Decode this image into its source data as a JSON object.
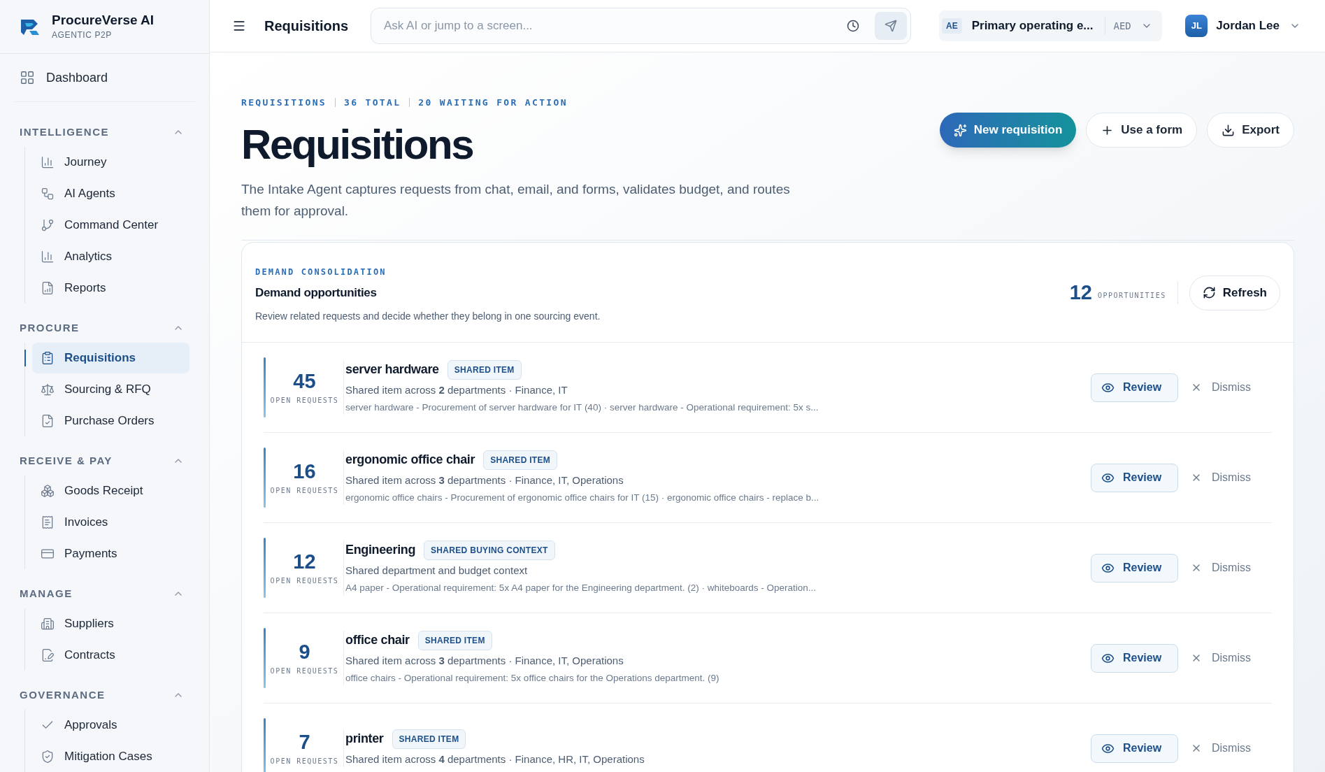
{
  "brand": {
    "name": "ProcureVerse AI",
    "tagline": "AGENTIC P2P"
  },
  "sidebar": {
    "top_item": {
      "label": "Dashboard",
      "selected": false
    },
    "sections": [
      {
        "title": "INTELLIGENCE",
        "expanded": true,
        "items": [
          {
            "label": "Journey",
            "selected": false
          },
          {
            "label": "AI Agents",
            "selected": false
          },
          {
            "label": "Command Center",
            "selected": false
          },
          {
            "label": "Analytics",
            "selected": false
          },
          {
            "label": "Reports",
            "selected": false
          }
        ]
      },
      {
        "title": "PROCURE",
        "expanded": true,
        "items": [
          {
            "label": "Requisitions",
            "selected": true
          },
          {
            "label": "Sourcing & RFQ",
            "selected": false
          },
          {
            "label": "Purchase Orders",
            "selected": false
          }
        ]
      },
      {
        "title": "RECEIVE & PAY",
        "expanded": true,
        "items": [
          {
            "label": "Goods Receipt",
            "selected": false
          },
          {
            "label": "Invoices",
            "selected": false
          },
          {
            "label": "Payments",
            "selected": false
          }
        ]
      },
      {
        "title": "MANAGE",
        "expanded": true,
        "items": [
          {
            "label": "Suppliers",
            "selected": false
          },
          {
            "label": "Contracts",
            "selected": false
          }
        ]
      },
      {
        "title": "GOVERNANCE",
        "expanded": true,
        "items": [
          {
            "label": "Approvals",
            "selected": false
          },
          {
            "label": "Mitigation Cases",
            "selected": false
          }
        ]
      }
    ]
  },
  "topbar": {
    "title": "Requisitions",
    "search": {
      "placeholder": "Ask AI or jump to a screen..."
    },
    "entity": {
      "code": "AE",
      "name": "Primary operating e...",
      "currency": "AED"
    },
    "user": {
      "initials": "JL",
      "name": "Jordan Lee"
    }
  },
  "header": {
    "stats": [
      "REQUISITIONS",
      "36 TOTAL",
      "20 WAITING FOR ACTION"
    ],
    "title": "Requisitions",
    "description": "The Intake Agent captures requests from chat, email, and forms, validates budget, and routes them for approval.",
    "buttons": [
      {
        "label": "New requisition",
        "kind": "primary"
      },
      {
        "label": "Use a form",
        "kind": "plus"
      },
      {
        "label": "Export",
        "kind": "download"
      }
    ]
  },
  "demand": {
    "eyebrow": "DEMAND CONSOLIDATION",
    "title": "Demand opportunities",
    "subtitle": "Review related requests and decide whether they belong in one sourcing event.",
    "count": "12",
    "count_label": "OPPORTUNITIES",
    "refresh": "Refresh",
    "rows": [
      {
        "count": "45",
        "count_label": "OPEN REQUESTS",
        "name": "server hardware",
        "tag": "SHARED ITEM",
        "summary": "Shared item across **2** departments · Finance, IT",
        "details": "server hardware - Procurement of server hardware for IT (40) · server hardware - Operational requirement: 5x s...",
        "review": "Review",
        "dismiss": "Dismiss"
      },
      {
        "count": "16",
        "count_label": "OPEN REQUESTS",
        "name": "ergonomic office chair",
        "tag": "SHARED ITEM",
        "summary": "Shared item across **3** departments · Finance, IT, Operations",
        "details": "ergonomic office chairs - Procurement of ergonomic office chairs for IT (15) · ergonomic office chairs - replace b...",
        "review": "Review",
        "dismiss": "Dismiss"
      },
      {
        "count": "12",
        "count_label": "OPEN REQUESTS",
        "name": "Engineering",
        "tag": "SHARED BUYING CONTEXT",
        "summary": "Shared department and budget context",
        "details": "A4 paper - Operational requirement: 5x A4 paper for the Engineering department. (2) · whiteboards - Operation...",
        "review": "Review",
        "dismiss": "Dismiss"
      },
      {
        "count": "9",
        "count_label": "OPEN REQUESTS",
        "name": "office chair",
        "tag": "SHARED ITEM",
        "summary": "Shared item across **3** departments · Finance, IT, Operations",
        "details": "office chairs - Operational requirement: 5x office chairs for the Operations department. (9)",
        "review": "Review",
        "dismiss": "Dismiss"
      },
      {
        "count": "7",
        "count_label": "OPEN REQUESTS",
        "name": "printer",
        "tag": "SHARED ITEM",
        "summary": "Shared item across **4** departments · Finance, HR, IT, Operations",
        "review": "Review",
        "dismiss": "Dismiss"
      }
    ]
  }
}
